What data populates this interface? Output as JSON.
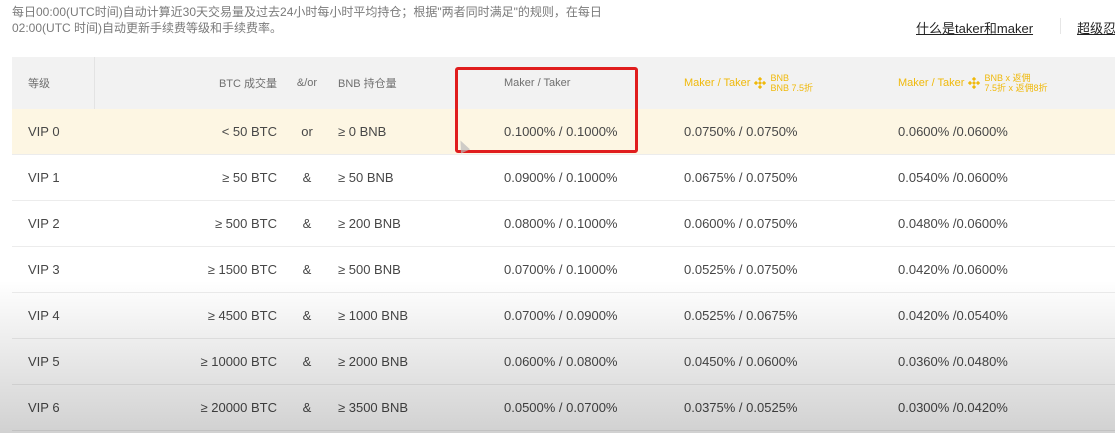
{
  "intro": {
    "line1": "每日00:00(UTC时间)自动计算近30天交易量及过去24小时每小时平均持仓；根据\"两者同时满足\"的规则，在每日",
    "line2": "02:00(UTC 时间)自动更新手续费等级和手续费率。"
  },
  "links": {
    "what_is": "什么是taker和maker",
    "super": "超级忍"
  },
  "table": {
    "headers": {
      "level": "等级",
      "btc": "BTC 成交量",
      "op": "&/or",
      "bnb": "BNB 持仓量",
      "mt": "Maker / Taker",
      "mt_bnb": "Maker / Taker",
      "mt_bnb_sub1": "BNB",
      "mt_bnb_sub2": "BNB 7.5折",
      "mt_bnb_ref": "Maker / Taker",
      "mt_bnb_ref_sub1": "BNB x 返佣",
      "mt_bnb_ref_sub2": "7.5折 x 返佣8折"
    },
    "rows": [
      {
        "level": "VIP 0",
        "btc": "< 50 BTC",
        "op": "or",
        "bnb": "≥ 0 BNB",
        "mt": "0.1000% / 0.1000%",
        "mt_bnb": "0.0750% / 0.0750%",
        "mt_ref": "0.0600% /0.0600%"
      },
      {
        "level": "VIP 1",
        "btc": "≥ 50 BTC",
        "op": "&",
        "bnb": "≥ 50 BNB",
        "mt": "0.0900% / 0.1000%",
        "mt_bnb": "0.0675% / 0.0750%",
        "mt_ref": "0.0540% /0.0600%"
      },
      {
        "level": "VIP 2",
        "btc": "≥ 500 BTC",
        "op": "&",
        "bnb": "≥ 200 BNB",
        "mt": "0.0800% / 0.1000%",
        "mt_bnb": "0.0600% / 0.0750%",
        "mt_ref": "0.0480% /0.0600%"
      },
      {
        "level": "VIP 3",
        "btc": "≥ 1500 BTC",
        "op": "&",
        "bnb": "≥ 500 BNB",
        "mt": "0.0700% / 0.1000%",
        "mt_bnb": "0.0525% / 0.0750%",
        "mt_ref": "0.0420% /0.0600%"
      },
      {
        "level": "VIP 4",
        "btc": "≥ 4500 BTC",
        "op": "&",
        "bnb": "≥ 1000 BNB",
        "mt": "0.0700% / 0.0900%",
        "mt_bnb": "0.0525% / 0.0675%",
        "mt_ref": "0.0420% /0.0540%"
      },
      {
        "level": "VIP 5",
        "btc": "≥ 10000 BTC",
        "op": "&",
        "bnb": "≥ 2000 BNB",
        "mt": "0.0600% / 0.0800%",
        "mt_bnb": "0.0450% / 0.0600%",
        "mt_ref": "0.0360% /0.0480%"
      },
      {
        "level": "VIP 6",
        "btc": "≥ 20000 BTC",
        "op": "&",
        "bnb": "≥ 3500 BNB",
        "mt": "0.0500% / 0.0700%",
        "mt_bnb": "0.0375% / 0.0525%",
        "mt_ref": "0.0300% /0.0420%"
      }
    ]
  },
  "colors": {
    "accent_gold": "#f0b90b",
    "highlight_row": "#fdf6e3",
    "annotation_red": "#e01d1d"
  }
}
